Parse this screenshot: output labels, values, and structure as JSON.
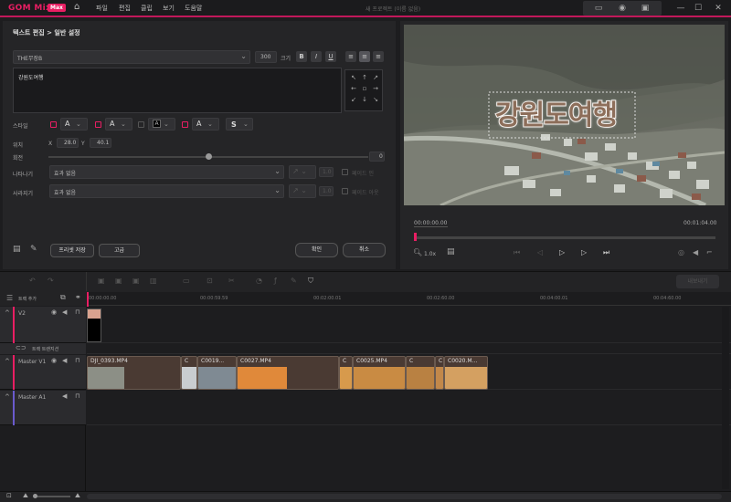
{
  "app": {
    "logo": "GOM Mix",
    "badge": "Max",
    "project_title": "새 프로젝트 (이름 없음)"
  },
  "menu": [
    "파일",
    "편집",
    "클립",
    "보기",
    "도움말"
  ],
  "editor": {
    "breadcrumb": "텍스트 편집 > 일반 설정",
    "font": "THE무장B",
    "size": "300",
    "size_label": "크기",
    "bold": "B",
    "italic": "I",
    "underline": "U",
    "text_value": "강원도여행",
    "style_label": "스타일",
    "shadow_letter": "S",
    "position_label": "위치",
    "x_label": "X",
    "x_value": "28.0",
    "y_label": "Y",
    "y_value": "40.1",
    "rotation_label": "회전",
    "rotation_value": "0",
    "rotation_percent": 50,
    "appear_label": "나타나기",
    "appear_value": "효과 없음",
    "appear_duration": "1.0",
    "fadein_label": "페이드 인",
    "disappear_label": "사라지기",
    "disappear_value": "효과 없음",
    "disappear_duration": "1.0",
    "fadeout_label": "페이드 아웃",
    "preset_save": "프리셋 저장",
    "advanced": "고급",
    "ok": "확인",
    "cancel": "취소"
  },
  "preview": {
    "overlay_text": "강원도여행",
    "current_time": "00:00:00.00",
    "total_time": "00:01:04.00",
    "zoom": "1.0x"
  },
  "timeline": {
    "add_track": "트랙 추가",
    "export": "내보내기",
    "ruler": [
      "00:00:00.00",
      "00:00:59.59",
      "00:02:00.01",
      "00:02:60.00",
      "00:04:00.01",
      "00:04:60.00"
    ],
    "tracks": {
      "v2": "V2",
      "transition": "트랙 트랜지션",
      "v1": "Master V1",
      "a1": "Master A1"
    },
    "clips": [
      "DJI_0393.MP4",
      "C",
      "C0019...",
      "C0027.MP4",
      "C",
      "C0025.MP4",
      "C",
      "C",
      "C0020.M..."
    ]
  },
  "colors": {
    "accent": "#e91e63",
    "bg": "#1d1d1f",
    "panel": "#252527"
  },
  "icons": [
    "home-icon",
    "caption-icon",
    "record-icon",
    "save-icon",
    "minimize-icon",
    "maximize-icon",
    "close-icon"
  ]
}
